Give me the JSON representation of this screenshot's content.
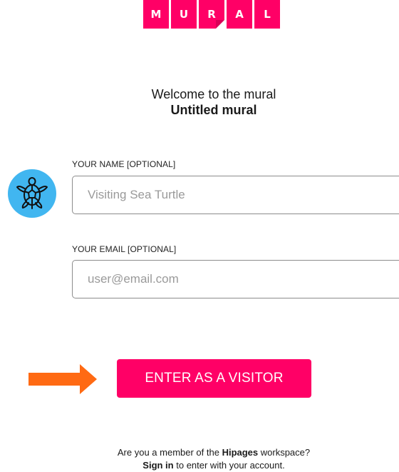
{
  "logo": {
    "letters": [
      "M",
      "U",
      "R",
      "A",
      "L"
    ],
    "color": "#ff0066"
  },
  "welcome": {
    "line1": "Welcome to the mural",
    "line2": "Untitled mural"
  },
  "avatar": {
    "icon": "sea-turtle-icon",
    "background": "#41b6f0"
  },
  "form": {
    "name_label": "YOUR NAME [OPTIONAL]",
    "name_placeholder": "Visiting Sea Turtle",
    "email_label": "YOUR EMAIL [OPTIONAL]",
    "email_placeholder": "user@email.com"
  },
  "arrow": {
    "icon": "arrow-right-icon",
    "color": "#ff6a13"
  },
  "enter_button": {
    "label": "ENTER AS A VISITOR",
    "color": "#ff0066"
  },
  "footer": {
    "line1_pre": "Are you a member of the ",
    "workspace": "Hipages",
    "line1_post": " workspace?",
    "signin": "Sign in",
    "line2_post": " to enter with your account."
  }
}
